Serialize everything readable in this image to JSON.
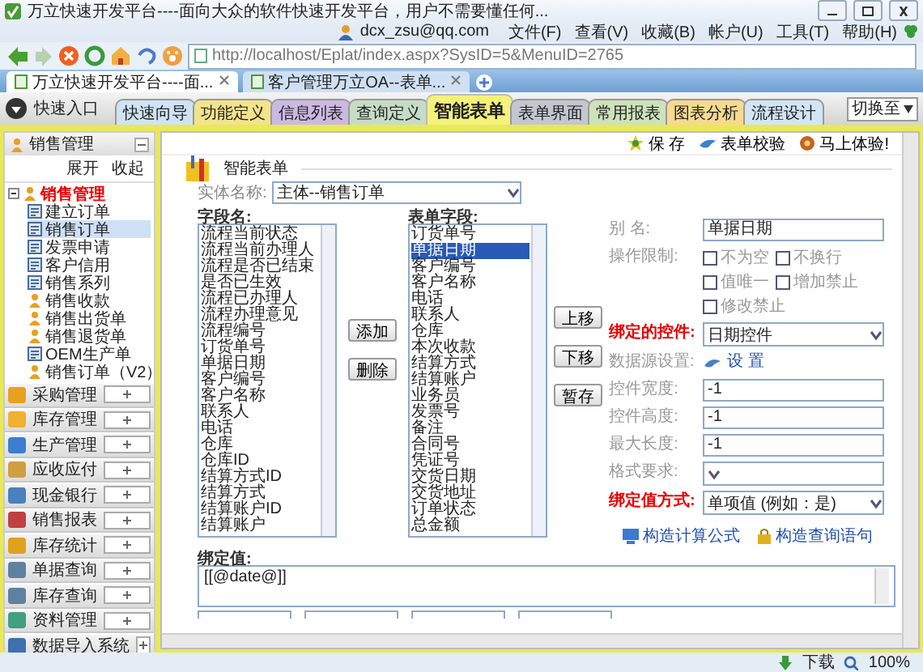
{
  "browser": {
    "title": "万立快速开发平台----面向大众的软件快速开发平台，用户不需要懂任何...",
    "account": "dcx_zsu@qq.com",
    "menus": [
      "文件(F)",
      "查看(V)",
      "收藏(B)",
      "帐户(U)",
      "工具(T)",
      "帮助(H)"
    ],
    "address": "http://localhost/Eplat/index.aspx?SysID=5&MenuID=2765",
    "tabs": [
      {
        "label": "万立快速开发平台----面...",
        "selected": true
      },
      {
        "label": "客户管理万立OA--表单...",
        "selected": false
      }
    ],
    "status_bar": {
      "download": "下载",
      "zoom": "100%"
    }
  },
  "nav": {
    "quick_entry": "快速入口",
    "switch": "切换至",
    "tabs": [
      {
        "label": "快速向导",
        "selected": false,
        "color": "#cfe3f3"
      },
      {
        "label": "功能定义",
        "selected": false,
        "color": "#f3e38a"
      },
      {
        "label": "信息列表",
        "selected": false,
        "color": "#cbb9e2"
      },
      {
        "label": "查询定义",
        "selected": false,
        "color": "#c6dcc6"
      },
      {
        "label": "智能表单",
        "selected": true,
        "color": "#f4f27a"
      },
      {
        "label": "表单界面",
        "selected": false,
        "color": "#c2c6d0"
      },
      {
        "label": "常用报表",
        "selected": false,
        "color": "#cde2ba"
      },
      {
        "label": "图表分析",
        "selected": false,
        "color": "#f7d98f"
      },
      {
        "label": "流程设计",
        "selected": false,
        "color": "#d2e5f5"
      }
    ]
  },
  "sidebar": {
    "title": "销售管理",
    "expand": "展开",
    "collapse": "收起",
    "tree": [
      {
        "label": "销售管理",
        "kind": "group",
        "selected": false,
        "expanded": true,
        "children": [
          {
            "label": "建立订单",
            "kind": "doc",
            "selected": false
          },
          {
            "label": "销售订单",
            "kind": "doc",
            "selected": true
          },
          {
            "label": "发票申请",
            "kind": "doc",
            "selected": false
          },
          {
            "label": "客户信用",
            "kind": "doc",
            "selected": false
          },
          {
            "label": "销售系列",
            "kind": "doc",
            "selected": false
          },
          {
            "label": "销售收款",
            "kind": "person",
            "selected": false
          },
          {
            "label": "销售出货单",
            "kind": "person",
            "selected": false
          },
          {
            "label": "销售退货单",
            "kind": "person",
            "selected": false
          },
          {
            "label": "OEM生产单",
            "kind": "doc",
            "selected": false
          },
          {
            "label": "销售订单（V2）",
            "kind": "person",
            "selected": false
          }
        ]
      }
    ],
    "modules": [
      {
        "label": "采购管理",
        "color": "#e8a020"
      },
      {
        "label": "库存管理",
        "color": "#f0b030"
      },
      {
        "label": "生产管理",
        "color": "#3a7fd0"
      },
      {
        "label": "应收应付",
        "color": "#d0a040"
      },
      {
        "label": "现金银行",
        "color": "#4a80c0"
      },
      {
        "label": "销售报表",
        "color": "#c04040"
      },
      {
        "label": "库存统计",
        "color": "#e0a020"
      },
      {
        "label": "单据查询",
        "color": "#6080a0"
      },
      {
        "label": "库存查询",
        "color": "#6080a0"
      },
      {
        "label": "资料管理",
        "color": "#40a080"
      },
      {
        "label": "数据导入系统",
        "color": "#4070b0"
      }
    ]
  },
  "toolbar": [
    {
      "label": "保 存",
      "kind": "save"
    },
    {
      "label": "表单校验",
      "kind": "check"
    },
    {
      "label": "马上体验!",
      "kind": "try"
    }
  ],
  "form": {
    "title": "智能表单",
    "entity_label": "实体名称:",
    "entity": "主体--销售订单",
    "fields_label": "字段名:",
    "form_fields_label": "表单字段:",
    "fields": [
      {
        "label": "流程当前状态",
        "selected": false
      },
      {
        "label": "流程当前办理人",
        "selected": false
      },
      {
        "label": "流程是否已结束",
        "selected": false
      },
      {
        "label": "是否已生效",
        "selected": false
      },
      {
        "label": "流程已办理人",
        "selected": false
      },
      {
        "label": "流程办理意见",
        "selected": false
      },
      {
        "label": "流程编号",
        "selected": false
      },
      {
        "label": "订货单号",
        "selected": false
      },
      {
        "label": "单据日期",
        "selected": false
      },
      {
        "label": "客户编号",
        "selected": false
      },
      {
        "label": "客户名称",
        "selected": false
      },
      {
        "label": "联系人",
        "selected": false
      },
      {
        "label": "电话",
        "selected": false
      },
      {
        "label": "仓库",
        "selected": false
      },
      {
        "label": "仓库ID",
        "selected": false
      },
      {
        "label": "结算方式ID",
        "selected": false
      },
      {
        "label": "结算方式",
        "selected": false
      },
      {
        "label": "结算账户ID",
        "selected": false
      },
      {
        "label": "结算账户",
        "selected": false
      }
    ],
    "add": "添加",
    "remove": "删除",
    "form_fields": [
      {
        "label": "订货单号",
        "selected": false
      },
      {
        "label": "单据日期",
        "selected": true
      },
      {
        "label": "客户编号",
        "selected": false
      },
      {
        "label": "客户名称",
        "selected": false
      },
      {
        "label": "电话",
        "selected": false
      },
      {
        "label": "联系人",
        "selected": false
      },
      {
        "label": "仓库",
        "selected": false
      },
      {
        "label": "本次收款",
        "selected": false
      },
      {
        "label": "结算方式",
        "selected": false
      },
      {
        "label": "结算账户",
        "selected": false
      },
      {
        "label": "业务员",
        "selected": false
      },
      {
        "label": "发票号",
        "selected": false
      },
      {
        "label": "备注",
        "selected": false
      },
      {
        "label": "合同号",
        "selected": false
      },
      {
        "label": "凭证号",
        "selected": false
      },
      {
        "label": "交货日期",
        "selected": false
      },
      {
        "label": "交货地址",
        "selected": false
      },
      {
        "label": "订单状态",
        "selected": false
      },
      {
        "label": "总金额",
        "selected": false
      }
    ],
    "move_up": "上移",
    "move_down": "下移",
    "stash": "暂存",
    "properties": [
      {
        "kind": "text",
        "label": "别 名:",
        "value": "单据日期",
        "emphasis": false
      },
      {
        "kind": "checks",
        "label": "操作限制:",
        "emphasis": false,
        "options": [
          {
            "label": "不为空",
            "checked": false
          },
          {
            "label": "不换行",
            "checked": false
          },
          {
            "label": "值唯一",
            "checked": false
          },
          {
            "label": "增加禁止",
            "checked": false
          },
          {
            "label": "修改禁止",
            "checked": false
          }
        ]
      },
      {
        "kind": "select",
        "label": "绑定的控件:",
        "value": "日期控件",
        "emphasis": true
      },
      {
        "kind": "link",
        "label": "数据源设置:",
        "value": "设 置",
        "emphasis": false
      },
      {
        "kind": "text",
        "label": "控件宽度:",
        "value": "-1",
        "emphasis": false
      },
      {
        "kind": "text",
        "label": "控件高度:",
        "value": "-1",
        "emphasis": false
      },
      {
        "kind": "text",
        "label": "最大长度:",
        "value": "-1",
        "emphasis": false
      },
      {
        "kind": "select",
        "label": "格式要求:",
        "emphasis": false
      },
      {
        "kind": "select",
        "label": "绑定值方式:",
        "value": "单项值 (例如：是)",
        "emphasis": true
      }
    ],
    "actions": [
      {
        "label": "构造计算公式",
        "kind": "formula"
      },
      {
        "label": "构造查询语句",
        "kind": "query"
      }
    ],
    "bind_label": "绑定值:",
    "bind_value": "[[@date@]]"
  }
}
